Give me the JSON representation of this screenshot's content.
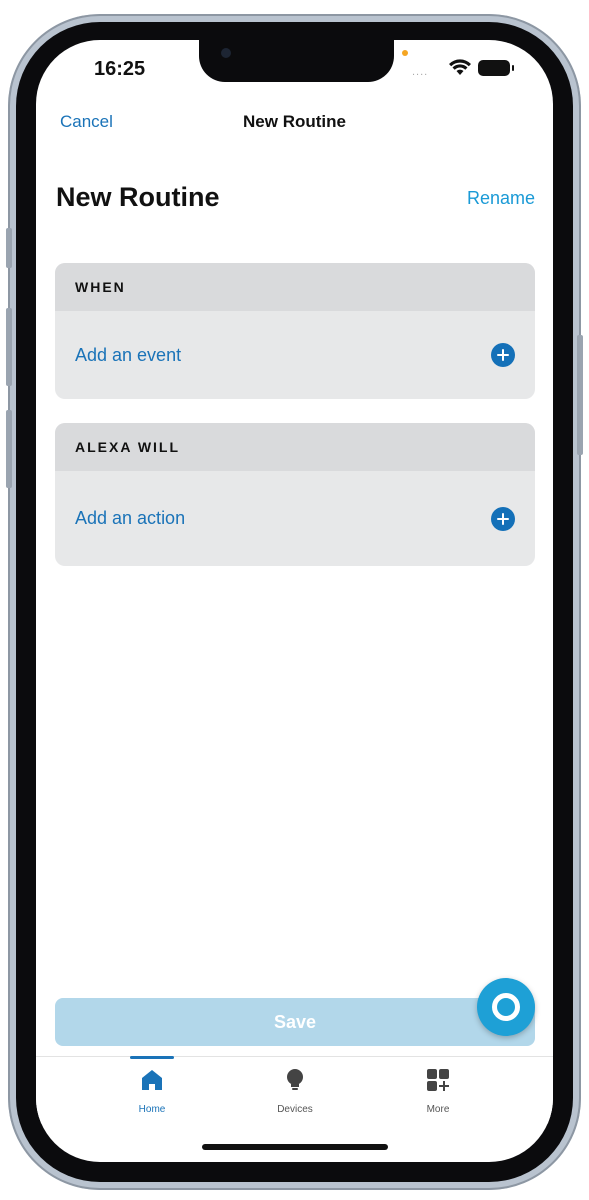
{
  "status_bar": {
    "time": "16:25",
    "signal_dots": "....",
    "icons": [
      "wifi-icon",
      "battery-icon"
    ]
  },
  "nav": {
    "cancel_label": "Cancel",
    "title": "New Routine"
  },
  "header": {
    "title": "New Routine",
    "rename_label": "Rename"
  },
  "sections": [
    {
      "heading": "WHEN",
      "row_label": "Add an event",
      "icon": "add-circle-icon"
    },
    {
      "heading": "ALEXA WILL",
      "row_label": "Add an action",
      "icon": "add-circle-icon"
    }
  ],
  "save_label": "Save",
  "alexa_button": {
    "icon": "alexa-ring-icon"
  },
  "tabs": [
    {
      "label": "Home",
      "icon": "home-icon",
      "active": true
    },
    {
      "label": "Devices",
      "icon": "lightbulb-icon",
      "active": false
    },
    {
      "label": "More",
      "icon": "more-grid-icon",
      "active": false
    }
  ],
  "colors": {
    "accent": "#1a73b8",
    "link": "#1a9ad6",
    "save_disabled": "#b2d7ea",
    "alexa": "#1ea0d6"
  }
}
